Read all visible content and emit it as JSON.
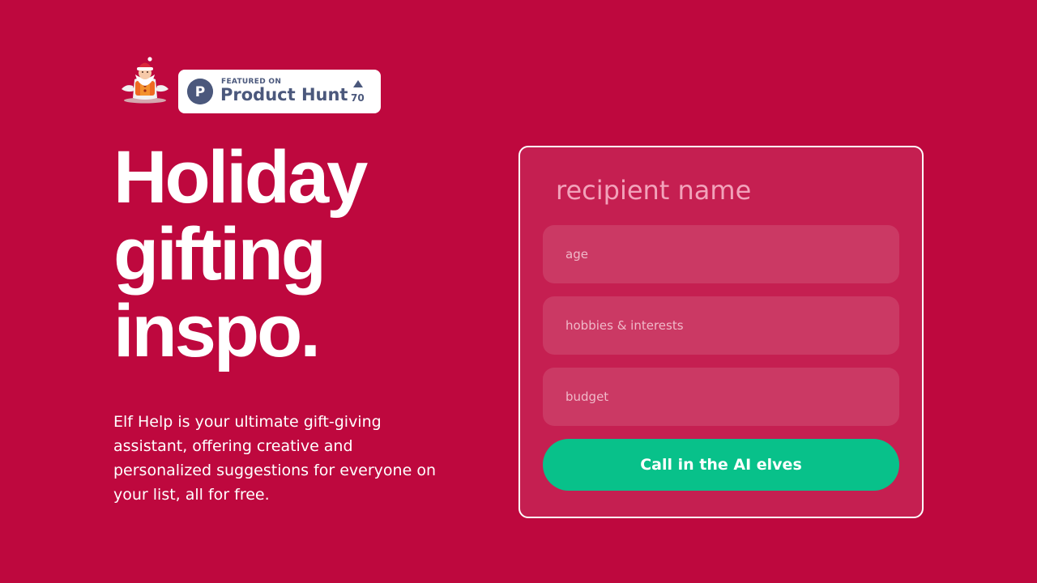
{
  "brand": {
    "logo_icon": "santa-elf-icon"
  },
  "product_hunt": {
    "featured_label": "FEATURED ON",
    "name": "Product Hunt",
    "logo_letter": "P",
    "upvote_icon": "triangle-up-icon",
    "upvote_count": "70",
    "color": "#4b587c"
  },
  "hero": {
    "headline_lines": [
      "Holiday",
      "gifting",
      "inspo."
    ],
    "description": "Elf Help is your ultimate gift-giving assistant, offering creative and personalized suggestions for everyone on your list, all for free."
  },
  "form": {
    "recipient_placeholder": "recipient name",
    "age_placeholder": "age",
    "hobbies_placeholder": "hobbies & interests",
    "budget_placeholder": "budget",
    "submit_label": "Call in the AI elves"
  },
  "colors": {
    "background": "#be083e",
    "card": "#c51f51",
    "field": "#cb3964",
    "accent": "#08c18a",
    "text": "#ffffff"
  }
}
